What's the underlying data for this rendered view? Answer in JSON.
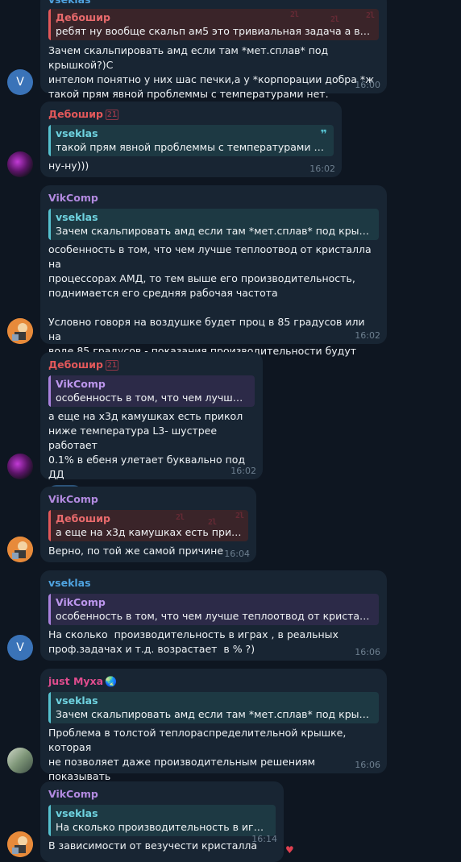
{
  "messages": [
    {
      "sender": "vseklas",
      "avatar_letter": "V",
      "reply": {
        "name": "Дебошир",
        "text": "ребят ну вообще скальп ам5 это тривиальная задача а вы сд..."
      },
      "text": "Зачем скальпировать амд если там *мет.сплав* под крышкой?)С\nинтелом понятно у них шас печки,а у *корпорации добра *ж\nтакой прям явной проблеммы с температурами нет.",
      "time": "16:00"
    },
    {
      "sender": "Дебошир",
      "badge": "21",
      "reply": {
        "name": "vseklas",
        "text": "такой прям явной проблеммы с температурами нет."
      },
      "quote_icon": "❞",
      "text": "ну-ну)))",
      "time": "16:02"
    },
    {
      "sender": "VikComp",
      "reply": {
        "name": "vseklas",
        "text": "Зачем скальпировать амд если там *мет.сплав* под крышко..."
      },
      "text": "особенность в том, что чем лучше теплоотвод от кристалла на\nпроцессорах АМД, то тем выше его производительность,\nподнимается его средняя рабочая частота\n\nУсловно говоря на воздушке будет проц в 85 градусов или на\nводе 85 градусов - показания производительности будут разные",
      "time": "16:02"
    },
    {
      "sender": "Дебошир",
      "badge": "21",
      "reply": {
        "name": "VikComp",
        "text": "особенность в том, что чем лучше т..."
      },
      "text": "а еще на х3д камушках есть прикол\nниже температура L3- шустрее работает\n0.1% в ебеня улетает буквально под ДД",
      "reaction": "💯",
      "time": "16:02"
    },
    {
      "sender": "VikComp",
      "reply": {
        "name": "Дебошир",
        "text": "а еще на х3д камушках есть прико..."
      },
      "text": "Верно, по той же самой причине",
      "time": "16:04"
    },
    {
      "sender": "vseklas",
      "avatar_letter": "V",
      "reply": {
        "name": "VikComp",
        "text": "особенность в том, что чем лучше теплоотвод от кристалла ..."
      },
      "text": "На сколько  производительность в играх , в реальных\nпроф.задачах и т.д. возрастает  в % ?)",
      "time": "16:06"
    },
    {
      "sender": "just Муха",
      "sender_emoji": "🌏",
      "reply": {
        "name": "vseklas",
        "text": "Зачем скальпировать амд если там *мет.сплав* под крышко..."
      },
      "text": "Проблема в толстой теплораспределительной крышке, которая\nне позволяет даже производительным решениям показывать\nсебя так хорошо, как на интеле",
      "time": "16:06"
    },
    {
      "sender": "VikComp",
      "reply": {
        "name": "vseklas",
        "text": "На сколько  производительность в игра..."
      },
      "text": "В зависимости от везучести кристалла",
      "time": "16:14",
      "reaction_icon": "heart-icon"
    }
  ]
}
